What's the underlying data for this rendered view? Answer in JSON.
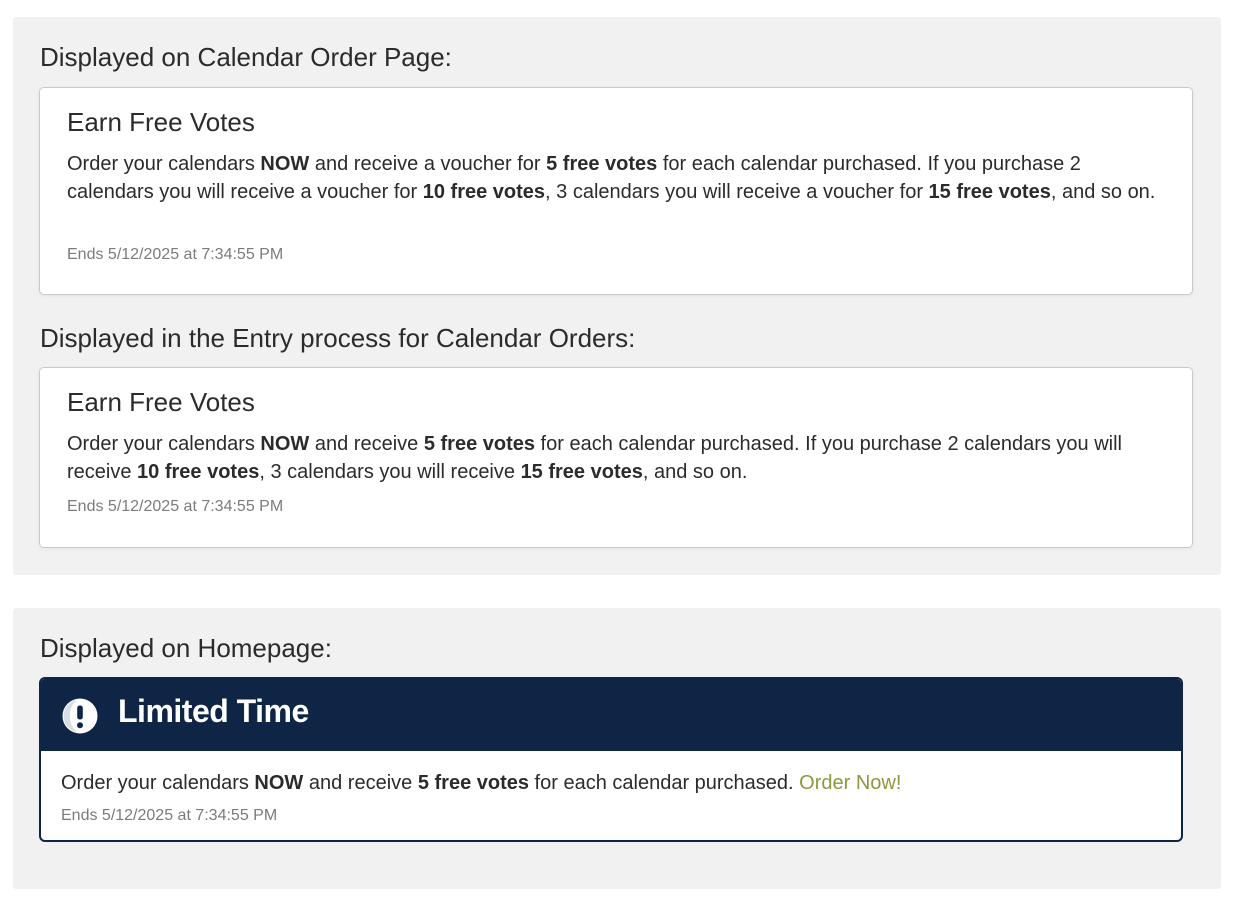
{
  "order_page": {
    "heading": "Displayed on Calendar Order Page:",
    "card": {
      "title": "Earn Free Votes",
      "text": [
        {
          "t": "Order your calendars ",
          "b": false
        },
        {
          "t": "NOW",
          "b": true
        },
        {
          "t": " and receive a voucher for ",
          "b": false
        },
        {
          "t": "5 free votes",
          "b": true
        },
        {
          "t": " for each calendar purchased. If you purchase 2 calendars you will receive a voucher for ",
          "b": false
        },
        {
          "t": "10 free votes",
          "b": true
        },
        {
          "t": ", 3 calendars you will receive a voucher for ",
          "b": false
        },
        {
          "t": "15 free votes",
          "b": true
        },
        {
          "t": ", and so on.",
          "b": false
        }
      ],
      "ends": "Ends 5/12/2025 at 7:34:55 PM"
    }
  },
  "entry_process": {
    "heading": "Displayed in the Entry process for Calendar Orders:",
    "card": {
      "title": "Earn Free Votes",
      "text": [
        {
          "t": "Order your calendars ",
          "b": false
        },
        {
          "t": "NOW",
          "b": true
        },
        {
          "t": " and receive ",
          "b": false
        },
        {
          "t": "5 free votes",
          "b": true
        },
        {
          "t": " for each calendar purchased. If you purchase 2 calendars you will receive ",
          "b": false
        },
        {
          "t": "10 free votes",
          "b": true
        },
        {
          "t": ", 3 calendars you will receive ",
          "b": false
        },
        {
          "t": "15 free votes",
          "b": true
        },
        {
          "t": ", and so on.",
          "b": false
        }
      ],
      "ends": "Ends 5/12/2025 at 7:34:55 PM"
    }
  },
  "homepage": {
    "heading": "Displayed on Homepage:",
    "alert": {
      "icon": "exclamation-circle-icon",
      "title": "Limited Time",
      "text": [
        {
          "t": "Order your calendars ",
          "b": false
        },
        {
          "t": "NOW",
          "b": true
        },
        {
          "t": " and receive ",
          "b": false
        },
        {
          "t": "5 free votes",
          "b": true
        },
        {
          "t": " for each calendar purchased. ",
          "b": false
        }
      ],
      "link_label": "Order Now!",
      "ends": "Ends 5/12/2025 at 7:34:55 PM"
    }
  },
  "colors": {
    "section_bg": "#f1f1f1",
    "alert_navy": "#0f2545",
    "link_olive": "#8a9a3c",
    "muted_text": "#7b7b7b"
  }
}
